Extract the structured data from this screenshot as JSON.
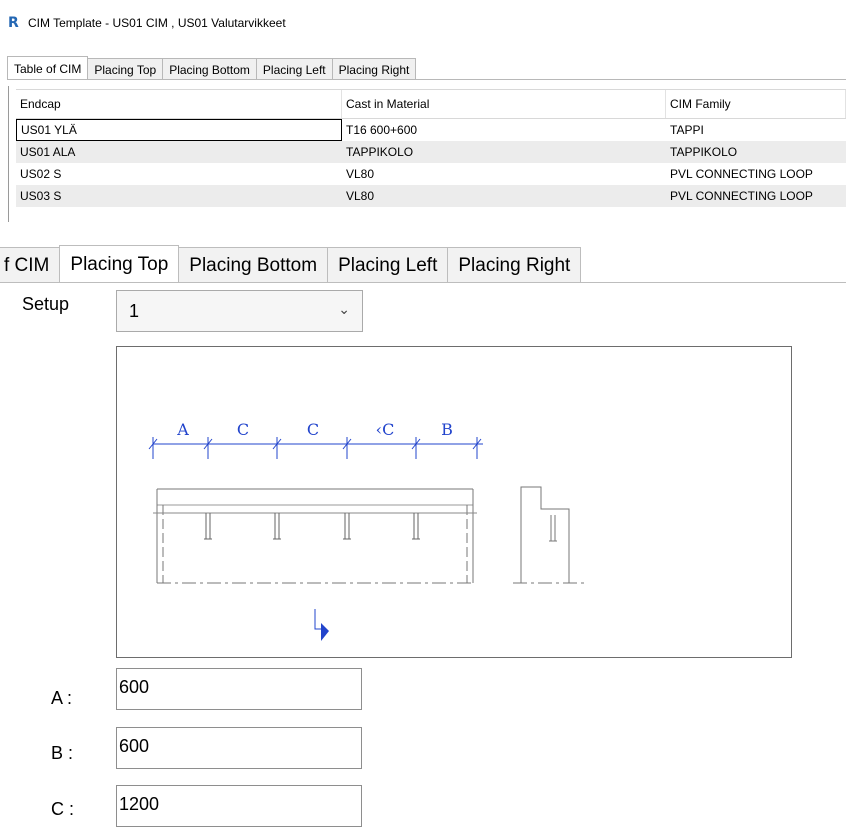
{
  "window": {
    "title": "CIM Template - US01 CIM , US01 Valutarvikkeet",
    "icon": "revit-r-icon"
  },
  "tabs": [
    "Table of CIM",
    "Placing Top",
    "Placing Bottom",
    "Placing Left",
    "Placing Right"
  ],
  "active_small_tab": "Table of CIM",
  "table": {
    "columns": [
      "Endcap",
      "Cast in Material",
      "CIM Family"
    ],
    "rows": [
      [
        "US01 YLÄ",
        "T16 600+600",
        "TAPPI"
      ],
      [
        "US01 ALA",
        "TAPPIKOLO",
        "TAPPIKOLO"
      ],
      [
        "US02 S",
        "VL80",
        "PVL CONNECTING LOOP"
      ],
      [
        "US03 S",
        "VL80",
        "PVL CONNECTING LOOP"
      ]
    ]
  },
  "zoomed": {
    "tabs": [
      "f CIM",
      "Placing Top",
      "Placing Bottom",
      "Placing Left",
      "Placing Right"
    ],
    "active_tab": "Placing Top",
    "setup": {
      "label": "Setup",
      "value": "1"
    },
    "diagram": {
      "dims": [
        "A",
        "C",
        "C",
        "‹C",
        "B"
      ],
      "accent": "#2244cc"
    },
    "fields": [
      {
        "label": "A :",
        "value": "600"
      },
      {
        "label": "B :",
        "value": "600"
      },
      {
        "label": "C :",
        "value": "1200"
      }
    ]
  }
}
